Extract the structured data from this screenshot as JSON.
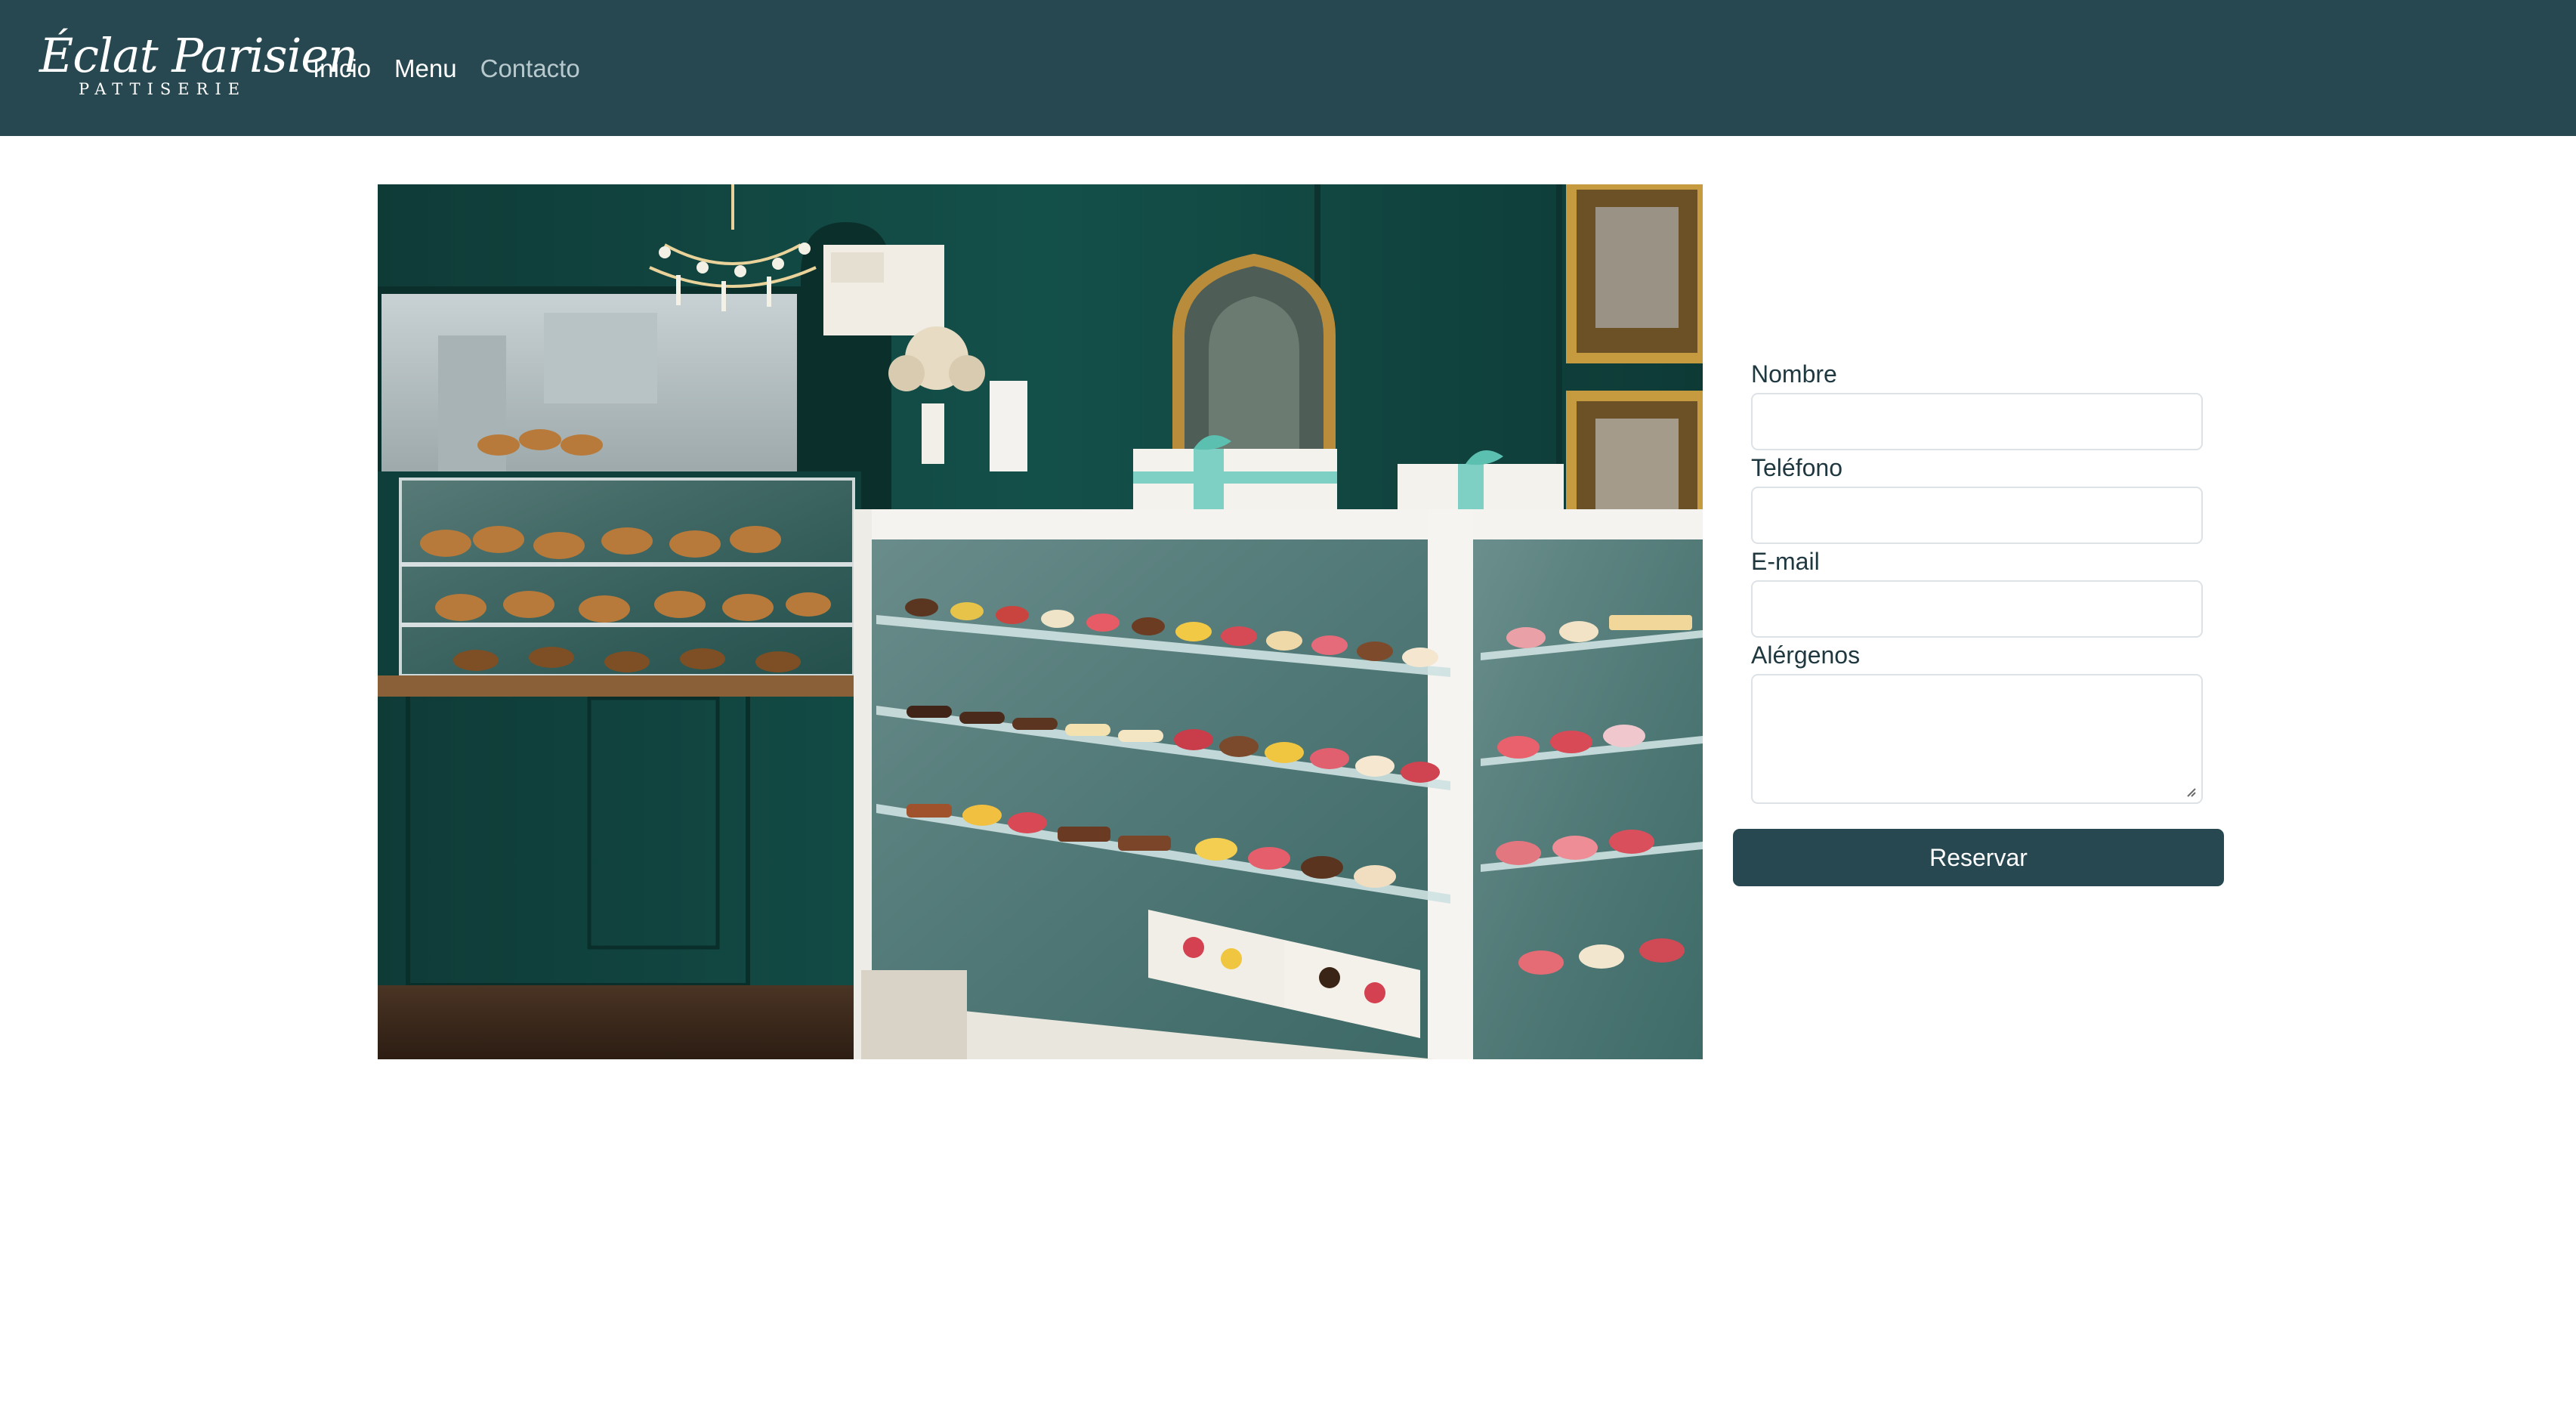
{
  "brand": {
    "name": "Éclat Parisien",
    "tagline": "PATTISERIE"
  },
  "nav": {
    "items": [
      {
        "label": "Inicio",
        "active": false
      },
      {
        "label": "Menu",
        "active": false
      },
      {
        "label": "Contacto",
        "active": true
      }
    ]
  },
  "photo": {
    "subject": "pastry-shop-display-case"
  },
  "form": {
    "fields": [
      {
        "label": "Nombre",
        "value": ""
      },
      {
        "label": "Teléfono",
        "value": ""
      },
      {
        "label": "E-mail",
        "value": ""
      },
      {
        "label": "Alérgenos",
        "value": ""
      }
    ],
    "submit_label": "Reservar"
  },
  "colors": {
    "navbar": "#284851",
    "accent": "#284851",
    "active_link": "#b7c9cd",
    "label_text": "#1f3840"
  }
}
